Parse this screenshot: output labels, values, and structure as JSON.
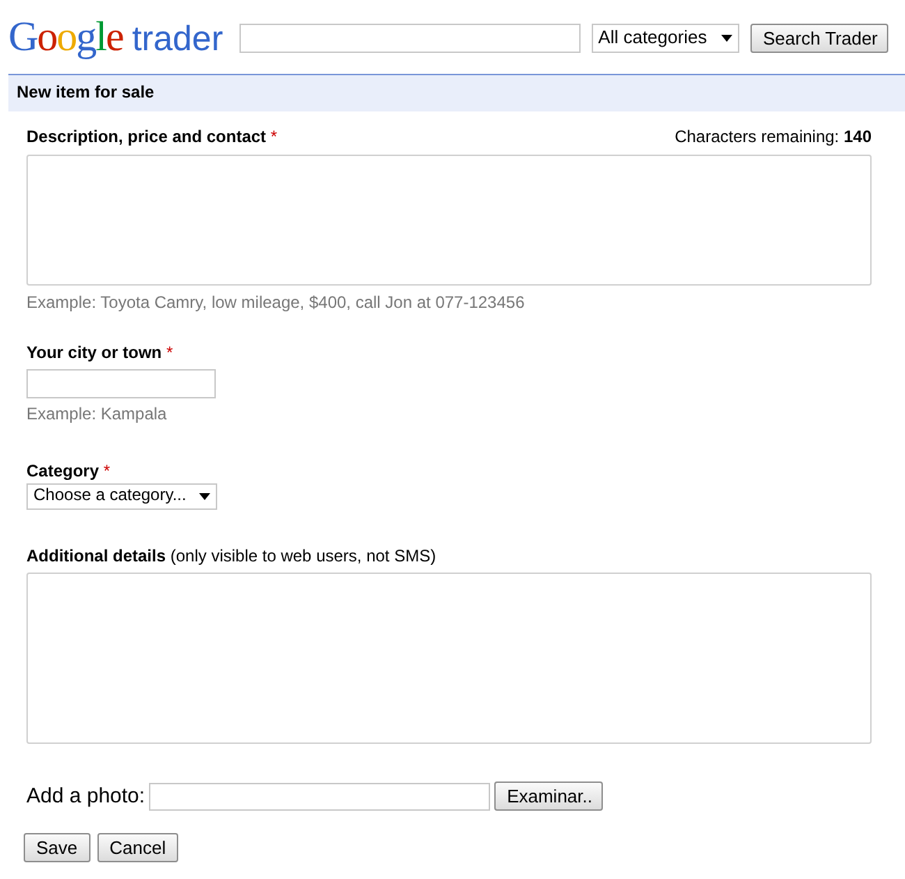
{
  "header": {
    "logo": {
      "brand": "Google",
      "product": "trader"
    },
    "category_select": {
      "value": "All categories"
    },
    "search_button": "Search Trader"
  },
  "section_title": "New item for sale",
  "description": {
    "label": "Description, price and contact",
    "required_mark": "*",
    "counter_label": "Characters remaining:",
    "counter_value": "140",
    "hint": "Example: Toyota Camry, low mileage, $400, call Jon at 077-123456"
  },
  "city": {
    "label": "Your city or town",
    "required_mark": "*",
    "hint": "Example: Kampala"
  },
  "category": {
    "label": "Category",
    "required_mark": "*",
    "value": "Choose a category..."
  },
  "additional": {
    "label": "**Additional details** (only visible to web users, not SMS)"
  },
  "photo": {
    "label": "Add a photo:",
    "browse_button": "Examinar.."
  },
  "buttons": [
    "Save",
    "Cancel"
  ]
}
